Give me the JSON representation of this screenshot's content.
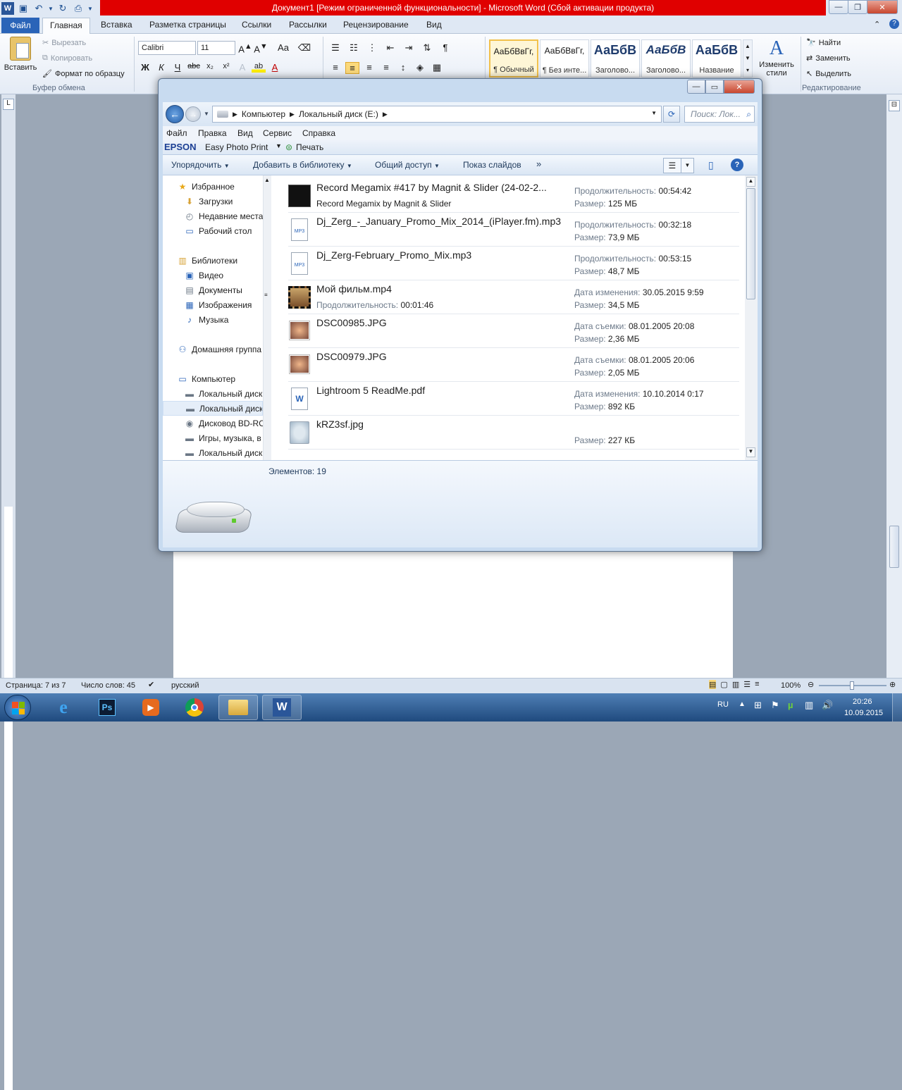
{
  "word": {
    "title": "Документ1 [Режим ограниченной функциональности]  -  Microsoft Word (Сбой активации продукта)",
    "tabs": {
      "file": "Файл",
      "home": "Главная",
      "insert": "Вставка",
      "layout": "Разметка страницы",
      "refs": "Ссылки",
      "mailings": "Рассылки",
      "review": "Рецензирование",
      "view": "Вид"
    },
    "clipboard": {
      "paste": "Вставить",
      "cut": "Вырезать",
      "copy": "Копировать",
      "format_painter": "Формат по образцу",
      "group": "Буфер обмена"
    },
    "font": {
      "name": "Calibri",
      "size": "11"
    },
    "styles": [
      {
        "sample": "АаБбВвГг,",
        "name": "¶ Обычный"
      },
      {
        "sample": "АаБбВвГг,",
        "name": "¶ Без инте..."
      },
      {
        "sample": "АаБбВ",
        "name": "Заголово..."
      },
      {
        "sample": "АаБбВ",
        "name": "Заголово..."
      },
      {
        "sample": "АаБбВ",
        "name": "Название"
      }
    ],
    "change_styles": "Изменить стили",
    "editing": {
      "find": "Найти",
      "replace": "Заменить",
      "select": "Выделить",
      "group": "Редактирование"
    },
    "status": {
      "page": "Страница: 7 из 7",
      "words": "Число слов: 45",
      "lang": "русский",
      "zoom": "100%"
    }
  },
  "explorer": {
    "breadcrumb": [
      "Компьютер",
      "Локальный диск (E:)"
    ],
    "search_placeholder": "Поиск: Лок...",
    "menu": [
      "Файл",
      "Правка",
      "Вид",
      "Сервис",
      "Справка"
    ],
    "epson": {
      "brand": "EPSON",
      "app": "Easy Photo Print",
      "print": "Печать"
    },
    "commands": {
      "organize": "Упорядочить",
      "add_library": "Добавить в библиотеку",
      "share": "Общий доступ",
      "slideshow": "Показ слайдов",
      "more": "»"
    },
    "nav": [
      {
        "label": "Избранное",
        "icon": "star-icon",
        "level": 0
      },
      {
        "label": "Загрузки",
        "icon": "downloads-icon",
        "level": 1
      },
      {
        "label": "Недавние места",
        "icon": "recent-places-icon",
        "level": 1
      },
      {
        "label": "Рабочий стол",
        "icon": "desktop-icon",
        "level": 1
      },
      {
        "label": "Библиотеки",
        "icon": "libraries-icon",
        "level": 0
      },
      {
        "label": "Видео",
        "icon": "video-icon",
        "level": 1
      },
      {
        "label": "Документы",
        "icon": "documents-icon",
        "level": 1
      },
      {
        "label": "Изображения",
        "icon": "pictures-icon",
        "level": 1
      },
      {
        "label": "Музыка",
        "icon": "music-icon",
        "level": 1
      },
      {
        "label": "Домашняя группа",
        "icon": "homegroup-icon",
        "level": 0
      },
      {
        "label": "Компьютер",
        "icon": "computer-icon",
        "level": 0
      },
      {
        "label": "Локальный диск",
        "icon": "drive-icon",
        "level": 1
      },
      {
        "label": "Локальный диск",
        "icon": "drive-icon",
        "level": 1
      },
      {
        "label": "Дисковод BD-RO",
        "icon": "optical-drive-icon",
        "level": 1
      },
      {
        "label": "Игры, музыка, в",
        "icon": "drive-icon",
        "level": 1
      },
      {
        "label": "Локальный диск",
        "icon": "drive-icon",
        "level": 1
      }
    ],
    "files": [
      {
        "name": "Record Megamix #417 by Magnit & Slider (24-02-2...",
        "sub": "Record Megamix by Magnit & Slider",
        "k1": "Продолжительность:",
        "v1": "00:54:42",
        "k2": "Размер:",
        "v2": "125 МБ",
        "icon": "album-art-icon"
      },
      {
        "name": "Dj_Zerg_-_January_Promo_Mix_2014_(iPlayer.fm).mp3",
        "k1": "Продолжительность:",
        "v1": "00:32:18",
        "k2": "Размер:",
        "v2": "73,9 МБ",
        "icon": "mp3-file-icon"
      },
      {
        "name": "Dj_Zerg-February_Promo_Mix.mp3",
        "k1": "Продолжительность:",
        "v1": "00:53:15",
        "k2": "Размер:",
        "v2": "48,7 МБ",
        "icon": "mp3-file-icon"
      },
      {
        "name": "Мой фильм.mp4",
        "subk": "Продолжительность:",
        "subv": "00:01:46",
        "k1": "Дата изменения:",
        "v1": "30.05.2015 9:59",
        "k2": "Размер:",
        "v2": "34,5 МБ",
        "icon": "video-file-icon"
      },
      {
        "name": "DSC00985.JPG",
        "k1": "Дата съемки:",
        "v1": "08.01.2005 20:08",
        "k2": "Размер:",
        "v2": "2,36 МБ",
        "icon": "photo-thumbnail-icon"
      },
      {
        "name": "DSC00979.JPG",
        "k1": "Дата съемки:",
        "v1": "08.01.2005 20:06",
        "k2": "Размер:",
        "v2": "2,05 МБ",
        "icon": "photo-thumbnail-icon"
      },
      {
        "name": "Lightroom 5 ReadMe.pdf",
        "k1": "Дата изменения:",
        "v1": "10.10.2014 0:17",
        "k2": "Размер:",
        "v2": "892 КБ",
        "icon": "word-document-icon"
      },
      {
        "name": "kRZ3sf.jpg",
        "k2": "Размер:",
        "v2": "227 КБ",
        "icon": "image-thumbnail-icon"
      }
    ],
    "count": "Элементов: 19"
  },
  "taskbar": {
    "lang": "RU",
    "time": "20:26",
    "date": "10.09.2015"
  }
}
